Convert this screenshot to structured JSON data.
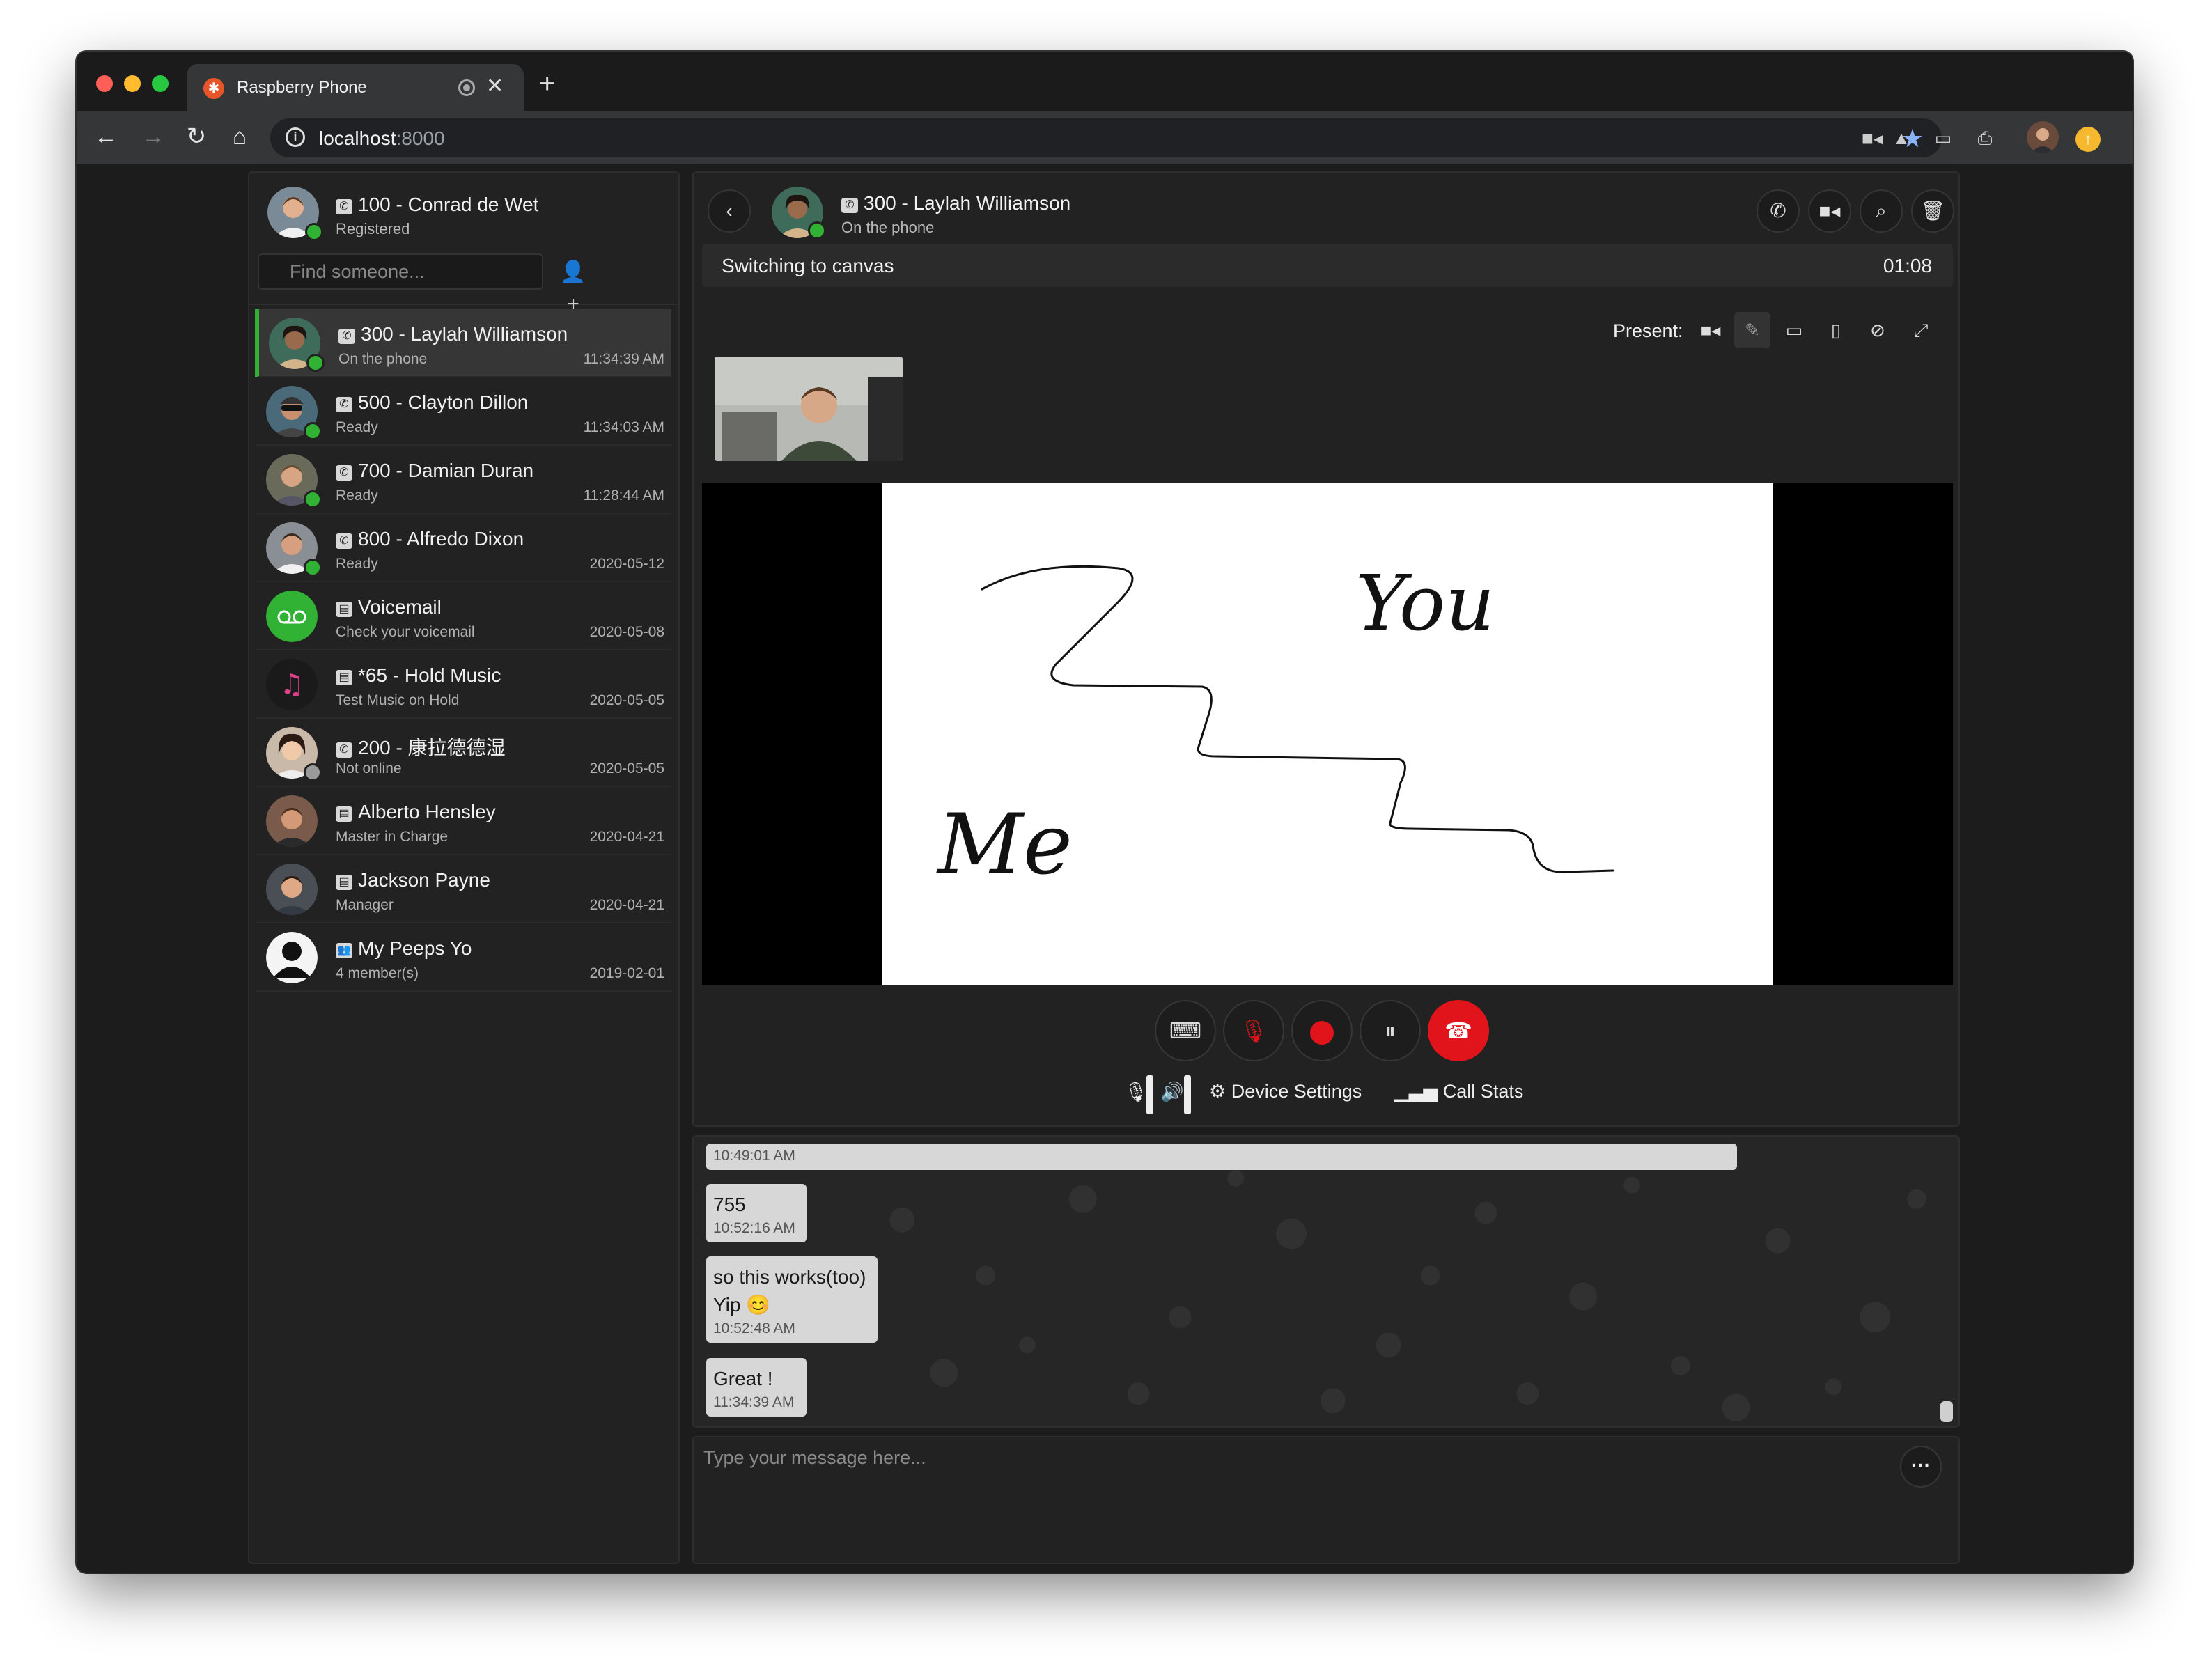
{
  "browser": {
    "tab_title": "Raspberry Phone",
    "url_host": "localhost",
    "url_port": ":8000"
  },
  "me": {
    "name": "100 - Conrad de Wet",
    "status": "Registered",
    "status_color": "#31b234"
  },
  "search": {
    "placeholder": "Find someone..."
  },
  "buddies": [
    {
      "name": "300 - Laylah Williamson",
      "sub": "On the phone",
      "time": "11:34:39 AM",
      "icon": "phone-icon",
      "dot": "#31b234",
      "selected": true
    },
    {
      "name": "500 - Clayton Dillon",
      "sub": "Ready",
      "time": "11:34:03 AM",
      "icon": "phone-icon",
      "dot": "#31b234"
    },
    {
      "name": "700 - Damian Duran",
      "sub": "Ready",
      "time": "11:28:44 AM",
      "icon": "phone-icon",
      "dot": "#31b234"
    },
    {
      "name": "800 - Alfredo Dixon",
      "sub": "Ready",
      "time": "2020-05-12",
      "icon": "phone-icon",
      "dot": "#31b234"
    },
    {
      "name": "Voicemail",
      "sub": "Check your voicemail",
      "time": "2020-05-08",
      "icon": "contact-card-icon"
    },
    {
      "name": "*65 - Hold Music",
      "sub": "Test Music on Hold",
      "time": "2020-05-05",
      "icon": "contact-card-icon"
    },
    {
      "name": "200 - 康拉德德湿",
      "sub": "Not online",
      "time": "2020-05-05",
      "icon": "phone-icon",
      "dot": "#9a9a9a"
    },
    {
      "name": "Alberto Hensley",
      "sub": "Master in Charge",
      "time": "2020-04-21",
      "icon": "contact-card-icon"
    },
    {
      "name": "Jackson Payne",
      "sub": "Manager",
      "time": "2020-04-21",
      "icon": "contact-card-icon"
    },
    {
      "name": "My Peeps Yo",
      "sub": "4 member(s)",
      "time": "2019-02-01",
      "icon": "group-icon"
    }
  ],
  "call": {
    "name": "300 - Laylah Williamson",
    "sub": "On the phone",
    "status_text": "Switching to canvas",
    "timer": "01:08",
    "present_label": "Present:",
    "device_settings": "Device Settings",
    "call_stats": "Call Stats",
    "canvas_text": [
      "You",
      "Me"
    ]
  },
  "chat": {
    "messages": [
      {
        "text": "",
        "time": "10:49:01 AM"
      },
      {
        "text": "755",
        "time": "10:52:16 AM"
      },
      {
        "text": "so this works(too)",
        "text2": "Yip 😊",
        "time": "10:52:48 AM"
      },
      {
        "text": "Great !",
        "time": "11:34:39 AM"
      }
    ],
    "compose_placeholder": "Type your message here..."
  },
  "colors": {
    "accent_green": "#31b234",
    "hangup_red": "#e0141a",
    "record_red": "#e0141a"
  }
}
